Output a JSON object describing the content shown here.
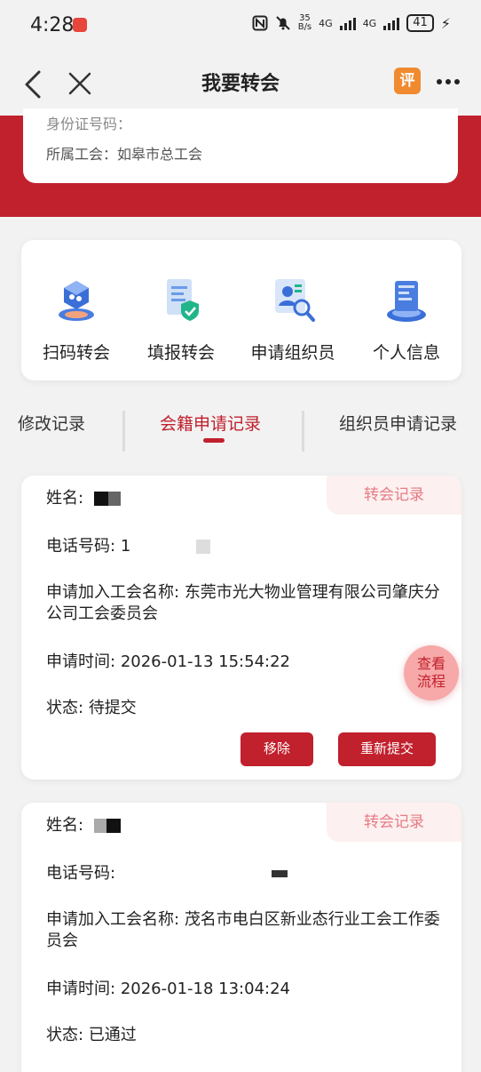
{
  "status_bar": {
    "time": "4:28",
    "net_speed_value": "35",
    "net_speed_unit": "B/s",
    "network_1": "4G",
    "network_2": "4G",
    "battery": "41"
  },
  "nav": {
    "title": "我要转会",
    "rate_label": "评"
  },
  "profile": {
    "id_label": "身份证号码：",
    "union_label": "所属工会：",
    "union_value": "如皋市总工会"
  },
  "actions": [
    {
      "label": "扫码转会",
      "icon": "scan-transfer-icon"
    },
    {
      "label": "填报转会",
      "icon": "fill-form-icon"
    },
    {
      "label": "申请组织员",
      "icon": "apply-organizer-icon"
    },
    {
      "label": "个人信息",
      "icon": "personal-info-icon"
    }
  ],
  "tabs": [
    {
      "label": "修改记录"
    },
    {
      "label": "会籍申请记录",
      "active": true
    },
    {
      "label": "组织员申请记录"
    }
  ],
  "records": [
    {
      "tag": "转会记录",
      "name_label": "姓名:",
      "name_value": "",
      "phone_label": "电话号码:",
      "phone_value": "1",
      "union_label": "申请加入工会名称:",
      "union_value": "东莞市光大物业管理有限公司肇庆分公司工会委员会",
      "time_label": "申请时间:",
      "time_value": "2026-01-13 15:54:22",
      "status_label": "状态:",
      "status_value": "待提交",
      "remove_label": "移除",
      "resubmit_label": "重新提交"
    },
    {
      "tag": "转会记录",
      "name_label": "姓名:",
      "name_value": "",
      "phone_label": "电话号码:",
      "phone_value": "",
      "union_label": "申请加入工会名称:",
      "union_value": "茂名市电白区新业态行业工会工作委员会",
      "time_label": "申请时间:",
      "time_value": "2026-01-18 13:04:24",
      "status_label": "状态:",
      "status_value": "已通过"
    }
  ],
  "flow_button": {
    "line1": "查看",
    "line2": "流程"
  },
  "colors": {
    "brand_red": "#c1202d",
    "tag_bg": "#fdf0f0",
    "page_bg": "#f2f2f2"
  }
}
